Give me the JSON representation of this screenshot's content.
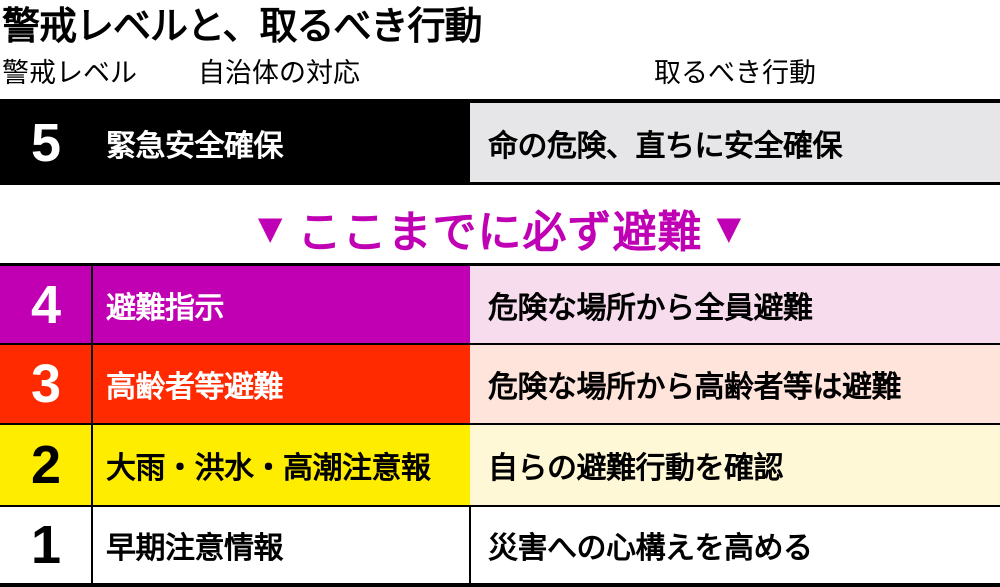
{
  "title": "警戒レベルと、取るべき行動",
  "headers": {
    "level": "警戒レベル",
    "municipal": "自治体の対応",
    "action": "取るべき行動"
  },
  "banner": {
    "text": "ここまでに必ず避難",
    "marker": "▼"
  },
  "levels": [
    {
      "level": "5",
      "municipal": "緊急安全確保",
      "action": "命の危険、直ちに安全確保",
      "colors": {
        "left_bg": "#000000",
        "left_text": "#ffffff",
        "right_bg": "#e6e6e8",
        "right_text": "#000000"
      }
    },
    {
      "level": "4",
      "municipal": "避難指示",
      "action": "危険な場所から全員避難",
      "colors": {
        "left_bg": "#c100b4",
        "left_text": "#ffffff",
        "right_bg": "#f6dcec",
        "right_text": "#000000"
      }
    },
    {
      "level": "3",
      "municipal": "高齢者等避難",
      "action": "危険な場所から高齢者等は避難",
      "colors": {
        "left_bg": "#ff2a00",
        "left_text": "#ffffff",
        "right_bg": "#ffe4dc",
        "right_text": "#000000"
      }
    },
    {
      "level": "2",
      "municipal": "大雨・洪水・高潮注意報",
      "action": "自らの避難行動を確認",
      "colors": {
        "left_bg": "#ffed00",
        "left_text": "#000000",
        "right_bg": "#fff8d6",
        "right_text": "#000000"
      }
    },
    {
      "level": "1",
      "municipal": "早期注意情報",
      "action": "災害への心構えを高める",
      "colors": {
        "left_bg": "#ffffff",
        "left_text": "#000000",
        "right_bg": "#ffffff",
        "right_text": "#000000"
      }
    }
  ]
}
